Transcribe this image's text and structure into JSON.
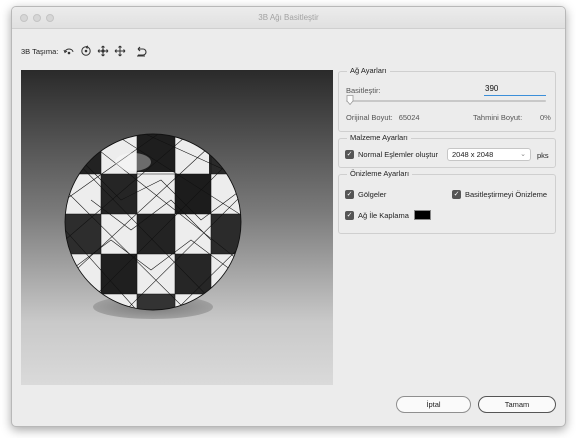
{
  "window": {
    "title": "3B Ağı Basitleştir"
  },
  "toolbar": {
    "label": "3B Taşıma:",
    "tools": [
      {
        "name": "rotate-icon"
      },
      {
        "name": "roll-icon"
      },
      {
        "name": "drag-icon"
      },
      {
        "name": "slide-icon"
      },
      {
        "name": "reset-icon"
      }
    ]
  },
  "mesh_settings": {
    "title": "Ağ Ayarları",
    "simplify_label": "Basitleştir:",
    "simplify_value": "390",
    "slider_value": 0.0,
    "original_size_label": "Orijinal Boyut:",
    "original_size_value": "65024",
    "estimated_size_label": "Tahmini Boyut:",
    "estimated_size_value": "0%"
  },
  "material_settings": {
    "title": "Malzeme Ayarları",
    "normal_maps_label": "Normal Eşlemler oluştur",
    "normal_maps_checked": true,
    "size_value": "2048 x 2048",
    "unit": "pks"
  },
  "preview_settings": {
    "title": "Önizleme Ayarları",
    "shadows_label": "Gölgeler",
    "shadows_checked": true,
    "preview_simplify_label": "Basitleştirmeyi Önizleme",
    "preview_simplify_checked": true,
    "mesh_overlay_label": "Ağ İle Kaplama",
    "mesh_overlay_checked": true,
    "mesh_overlay_color": "#000000"
  },
  "buttons": {
    "cancel": "İptal",
    "ok": "Tamam"
  }
}
